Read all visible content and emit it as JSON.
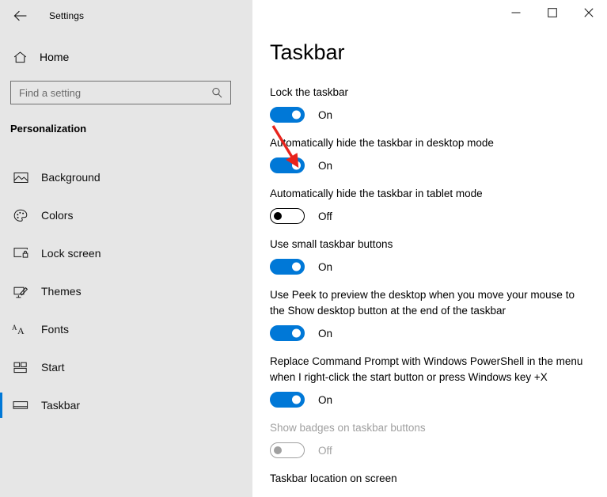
{
  "window": {
    "app_title": "Settings",
    "back_icon": "back-arrow-icon",
    "controls": {
      "minimize_label": "—",
      "maximize_label": "☐",
      "close_label": "✕"
    }
  },
  "sidebar": {
    "home": {
      "label": "Home",
      "icon": "home-icon"
    },
    "search": {
      "value": "",
      "placeholder": "Find a setting",
      "icon": "search-icon"
    },
    "section_title": "Personalization",
    "items": [
      {
        "label": "Background",
        "icon": "picture-icon",
        "selected": false
      },
      {
        "label": "Colors",
        "icon": "palette-icon",
        "selected": false
      },
      {
        "label": "Lock screen",
        "icon": "lock-screen-icon",
        "selected": false
      },
      {
        "label": "Themes",
        "icon": "brush-icon",
        "selected": false
      },
      {
        "label": "Fonts",
        "icon": "font-aa-icon",
        "selected": false
      },
      {
        "label": "Start",
        "icon": "start-tiles-icon",
        "selected": false
      },
      {
        "label": "Taskbar",
        "icon": "taskbar-icon",
        "selected": true
      }
    ]
  },
  "main": {
    "title": "Taskbar",
    "settings": [
      {
        "label": "Lock the taskbar",
        "state": "On",
        "on": true,
        "disabled": false
      },
      {
        "label": "Automatically hide the taskbar in desktop mode",
        "state": "On",
        "on": true,
        "disabled": false
      },
      {
        "label": "Automatically hide the taskbar in tablet mode",
        "state": "Off",
        "on": false,
        "disabled": false
      },
      {
        "label": "Use small taskbar buttons",
        "state": "On",
        "on": true,
        "disabled": false
      },
      {
        "label": "Use Peek to preview the desktop when you move your mouse to the Show desktop button at the end of the taskbar",
        "state": "On",
        "on": true,
        "disabled": false
      },
      {
        "label": "Replace Command Prompt with Windows PowerShell in the menu when I right-click the start button or press Windows key +X",
        "state": "On",
        "on": true,
        "disabled": false
      },
      {
        "label": "Show badges on taskbar buttons",
        "state": "Off",
        "on": false,
        "disabled": true
      }
    ],
    "next_section_label": "Taskbar location on screen"
  },
  "annotation": {
    "type": "arrow",
    "color": "#e8231c",
    "points_to": "Automatically hide the taskbar in desktop mode toggle"
  },
  "colors": {
    "accent": "#0078d7",
    "sidebar_bg": "#e6e6e6",
    "content_bg": "#ffffff",
    "annotation_red": "#e8231c",
    "disabled_gray": "#a0a0a0"
  }
}
